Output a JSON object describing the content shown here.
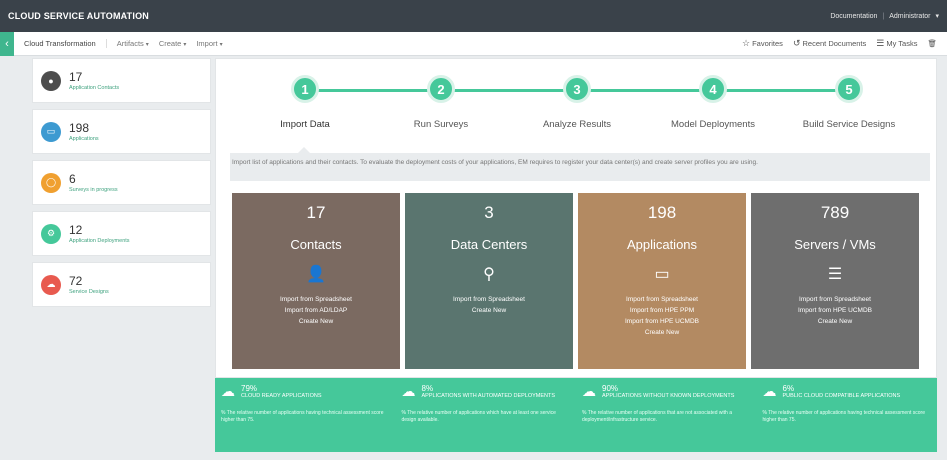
{
  "topbar": {
    "brand": "CLOUD SERVICE AUTOMATION",
    "documentation": "Documentation",
    "admin": "Administrator"
  },
  "navbar": {
    "breadcrumb": "Cloud Transformation",
    "menus": [
      "Artifacts",
      "Create",
      "Import"
    ],
    "favorites": "Favorites",
    "recent": "Recent Documents",
    "tasks": "My Tasks"
  },
  "sidebar": [
    {
      "value": "17",
      "label": "Application Contacts",
      "color": "#4d4d4d",
      "icon": "user-icon"
    },
    {
      "value": "198",
      "label": "Applications",
      "color": "#3d9ad1",
      "icon": "inbox-icon"
    },
    {
      "value": "6",
      "label": "Surveys in progress",
      "color": "#f0a030",
      "icon": "chat-icon"
    },
    {
      "value": "12",
      "label": "Application Deployments",
      "color": "#45c89a",
      "icon": "gears-icon"
    },
    {
      "value": "72",
      "label": "Service Designs",
      "color": "#e85a4f",
      "icon": "cloud-icon"
    }
  ],
  "steps": [
    {
      "n": "1",
      "label": "Import Data"
    },
    {
      "n": "2",
      "label": "Run Surveys"
    },
    {
      "n": "3",
      "label": "Analyze Results"
    },
    {
      "n": "4",
      "label": "Model Deployments"
    },
    {
      "n": "5",
      "label": "Build Service Designs"
    }
  ],
  "description": "Import list of applications and their contacts. To evaluate the deployment costs of your applications, EM requires to register your data center(s) and create server profiles you are using.",
  "tiles": [
    {
      "value": "17",
      "label": "Contacts",
      "color": "#7b6a61",
      "icon": "user-icon",
      "links": [
        "Import from Spreadsheet",
        "Import from AD/LDAP",
        "Create New"
      ]
    },
    {
      "value": "3",
      "label": "Data Centers",
      "color": "#5a756f",
      "icon": "location-pin-icon",
      "links": [
        "Import from Spreadsheet",
        "Create New"
      ]
    },
    {
      "value": "198",
      "label": "Applications",
      "color": "#b38a62",
      "icon": "inbox-icon",
      "links": [
        "Import from Spreadsheet",
        "Import from HPE PPM",
        "Import from HPE UCMDB",
        "Create New"
      ]
    },
    {
      "value": "789",
      "label": "Servers / VMs",
      "color": "#6e6e6e",
      "icon": "server-icon",
      "links": [
        "Import from Spreadsheet",
        "Import from HPE UCMDB",
        "Create New"
      ]
    }
  ],
  "metrics": [
    {
      "pct": "79%",
      "label": "CLOUD READY APPLICATIONS",
      "note": "% The relative number of applications having technical assessment score higher than 75."
    },
    {
      "pct": "8%",
      "label": "APPLICATIONS WITH AUTOMATED DEPLOYMENTS",
      "note": "% The relative number of applications which have at least one service design available."
    },
    {
      "pct": "90%",
      "label": "APPLICATIONS WITHOUT KNOWN DEPLOYMENTS",
      "note": "% The relative number of applications that are not associated with a deployment/infrastructure service."
    },
    {
      "pct": "6%",
      "label": "PUBLIC CLOUD COMPATIBLE APPLICATIONS",
      "note": "% The relative number of applications having technical assessment score higher than 75."
    }
  ]
}
